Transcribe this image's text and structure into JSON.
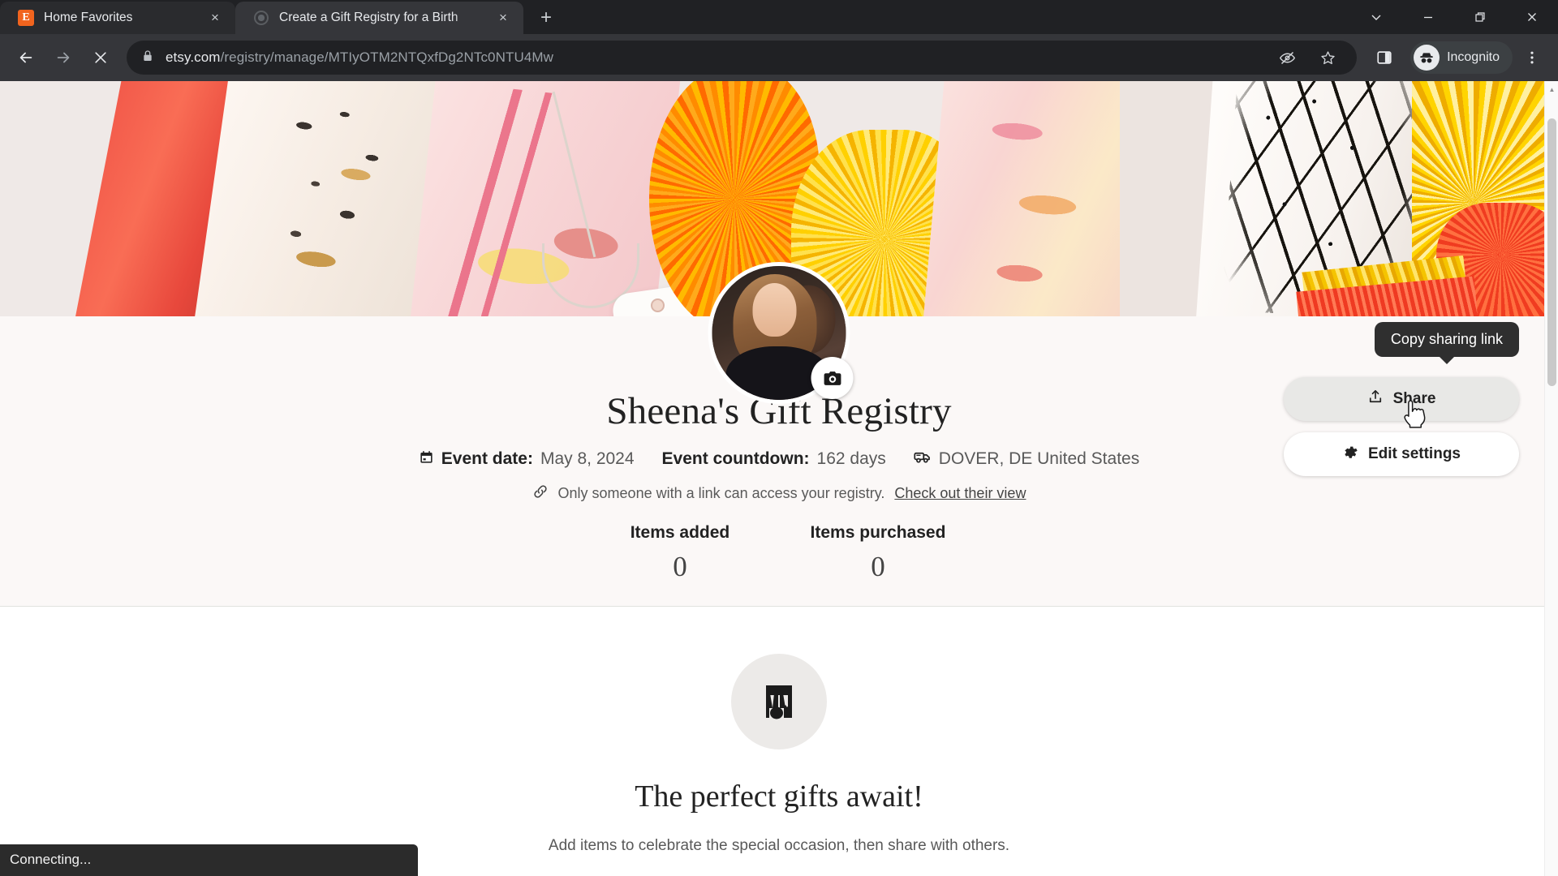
{
  "browser": {
    "tabs": [
      {
        "title": "Home Favorites",
        "favicon": "etsy-favicon",
        "active": false,
        "close_label": "×"
      },
      {
        "title": "Create a Gift Registry for a Birth",
        "favicon": "loading-spinner-icon",
        "active": true,
        "close_label": "×"
      }
    ],
    "new_tab_label": "+",
    "window_controls": {
      "tab_search_icon": "chevron-down-icon",
      "minimize_icon": "minimize-icon",
      "maximize_icon": "restore-icon",
      "close_icon": "close-icon"
    },
    "toolbar": {
      "back_icon": "back-arrow-icon",
      "forward_icon": "forward-arrow-icon",
      "stop_icon": "stop-loading-icon",
      "lock_icon": "lock-icon",
      "url_domain": "etsy.com",
      "url_path": "/registry/manage/MTIyOTM2NTQxfDg2NTc0NTU4Mw",
      "url_full": "etsy.com/registry/manage/MTIyOTM2NTQxfDg2NTc0NTU4Mw",
      "tracking_blocked_icon": "eye-slash-icon",
      "bookmark_icon": "star-icon",
      "side_panel_icon": "side-panel-icon",
      "profile_label": "Incognito",
      "profile_icon": "incognito-avatar-icon",
      "menu_icon": "three-dots-menu-icon"
    },
    "status_text": "Connecting..."
  },
  "page": {
    "banner": {
      "alt": "gift wrapping paper rolls banner"
    },
    "avatar": {
      "alt": "profile photo",
      "camera_icon": "camera-icon"
    },
    "tooltip": {
      "text": "Copy sharing link"
    },
    "actions": [
      {
        "label": "Share",
        "icon": "share-upload-icon",
        "state": "hovered"
      },
      {
        "label": "Edit settings",
        "icon": "gear-icon",
        "state": "default"
      }
    ],
    "title": "Sheena's Gift Registry",
    "meta": {
      "calendar_icon": "calendar-icon",
      "event_date_label": "Event date:",
      "event_date_value": "May 8, 2024",
      "countdown_label": "Event countdown:",
      "countdown_value": "162 days",
      "shipping_icon": "shipping-truck-icon",
      "location": "DOVER, DE United States"
    },
    "privacy": {
      "link_icon": "chain-link-icon",
      "text": "Only someone with a link can access your registry.",
      "link_label": "Check out their view"
    },
    "stats": [
      {
        "label": "Items added",
        "value": "0"
      },
      {
        "label": "Items purchased",
        "value": "0"
      }
    ],
    "empty_state": {
      "icon": "gift-shop-stall-icon",
      "title": "The perfect gifts await!",
      "subtitle": "Add items to celebrate the special occasion, then share with others."
    }
  },
  "colors": {
    "chrome_bg": "#202124",
    "toolbar_bg": "#35363a",
    "etsy_orange": "#f1641e",
    "text_dark": "#222222",
    "text_muted": "#595959",
    "tooltip_bg": "#2f2f2f"
  }
}
